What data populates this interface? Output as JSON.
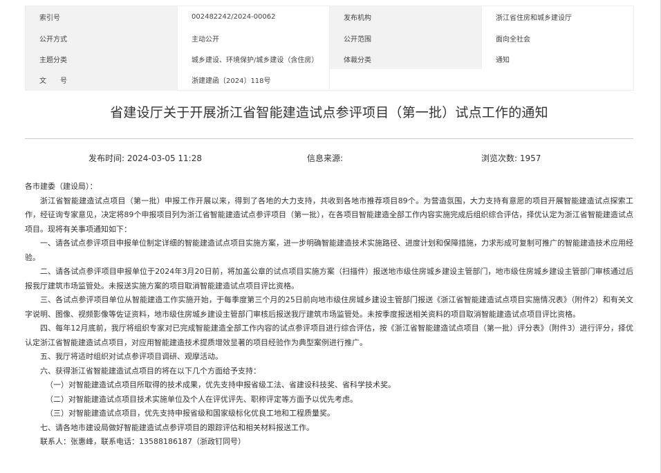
{
  "meta": {
    "rows": [
      {
        "label1": "索引号",
        "value1": "002482242/2024-00062",
        "label2": "发布机构",
        "value2": "浙江省住房和城乡建设厅"
      },
      {
        "label1": "公开方式",
        "value1": "主动公开",
        "label2": "公开范围",
        "value2": "面向全社会"
      },
      {
        "label1": "主题分类",
        "value1": "城乡建设、环境保护/城乡建设（含住房）",
        "label2": "体裁分类",
        "value2": "通知"
      },
      {
        "label1": "文　　号",
        "value1": "浙建建函〔2024〕118号",
        "label2": "",
        "value2": ""
      }
    ]
  },
  "article": {
    "title": "省建设厅关于开展浙江省智能建造试点参评项目（第一批）试点工作的通知",
    "publish_time": "发布时间:  2024-03-05 11:28",
    "source": "信息来源:",
    "views": "浏览次数: 1957"
  },
  "body": {
    "salutation": "各市建委（建设局）：",
    "paragraphs": [
      "浙江省智能建造试点项目（第一批）申报工作开展以来，得到了各地的大力支持，共收到各地市推荐项目89个。为营造氛围，大力支持有意愿的项目开展智能建造试点探索工作，经征询专家意见，决定将89个申报项目列为浙江省智能建造试点参评项目（第一批），在各项目智能建造全部工作内容实施完成后组织综合评估，择优认定为浙江省智能建造试点项目。现将有关事项通知如下：",
      "一、请各试点参评项目申报单位制定详细的智能建造试点项目实施方案，进一步明确智能建造技术实施路径、进度计划和保障措施，力求形成可复制可推广的智能建造技术应用经验。",
      "二、请各试点参评项目申报单位于2024年3月20日前，将加盖公章的试点项目实施方案（扫描件）报送地市级住房城乡建设主管部门，地市级住房城乡建设主管部门审核通过后报我厅建筑市场监管处。未报送实施方案的项目取消智能建造试点项目评比资格。",
      "三、各试点参评项目单位从智能建造工作实施开始，于每季度第三个月的25日前向地市级住房城乡建设主管部门报送《浙江省智能建造试点项目实施情况表》（附件2）和有关文字说明、图像、视频影像等佐证资料，地市级住房城乡建设主管部门审核后报送我厅建筑市场监管处。未按季度报送相关资料的项目取消智能建造试点项目评比资格。",
      "四、每年12月底前，我厅将组织专家对已完成智能建造全部工作内容的试点参评项目进行综合评估，按《浙江省智能建造试点项目（第一批）评分表》（附件3）进行评分，择优认定浙江省智能建造试点项目，对应用智能建造技术提质增效显著的项目经验作为典型案例进行推广。",
      "五、我厅将适时组织对试点参评项目调研、观摩活动。",
      "六、获得浙江省智能建造试点项目的将在以下几个方面给予支持："
    ],
    "sub_items": [
      "（一）对智能建造试点项目所取得的技术成果，优先支持申报省级工法、省建设科技奖、省科学技术奖。",
      "（二）对智能建造试点项目技术实施单位及个人在评优评先、职称评定等方面予以优先考虑。",
      "（三）对智能建造试点项目，优先支持申报省级和国家级标化优良工地和工程质量奖。"
    ],
    "closing": [
      "七、请各地市建设局做好智能建造试点参评项目的跟踪评估和相关材料报送工作。",
      "联系人：张惠峰，联系电话：13588186187（浙政钉同号）"
    ]
  }
}
